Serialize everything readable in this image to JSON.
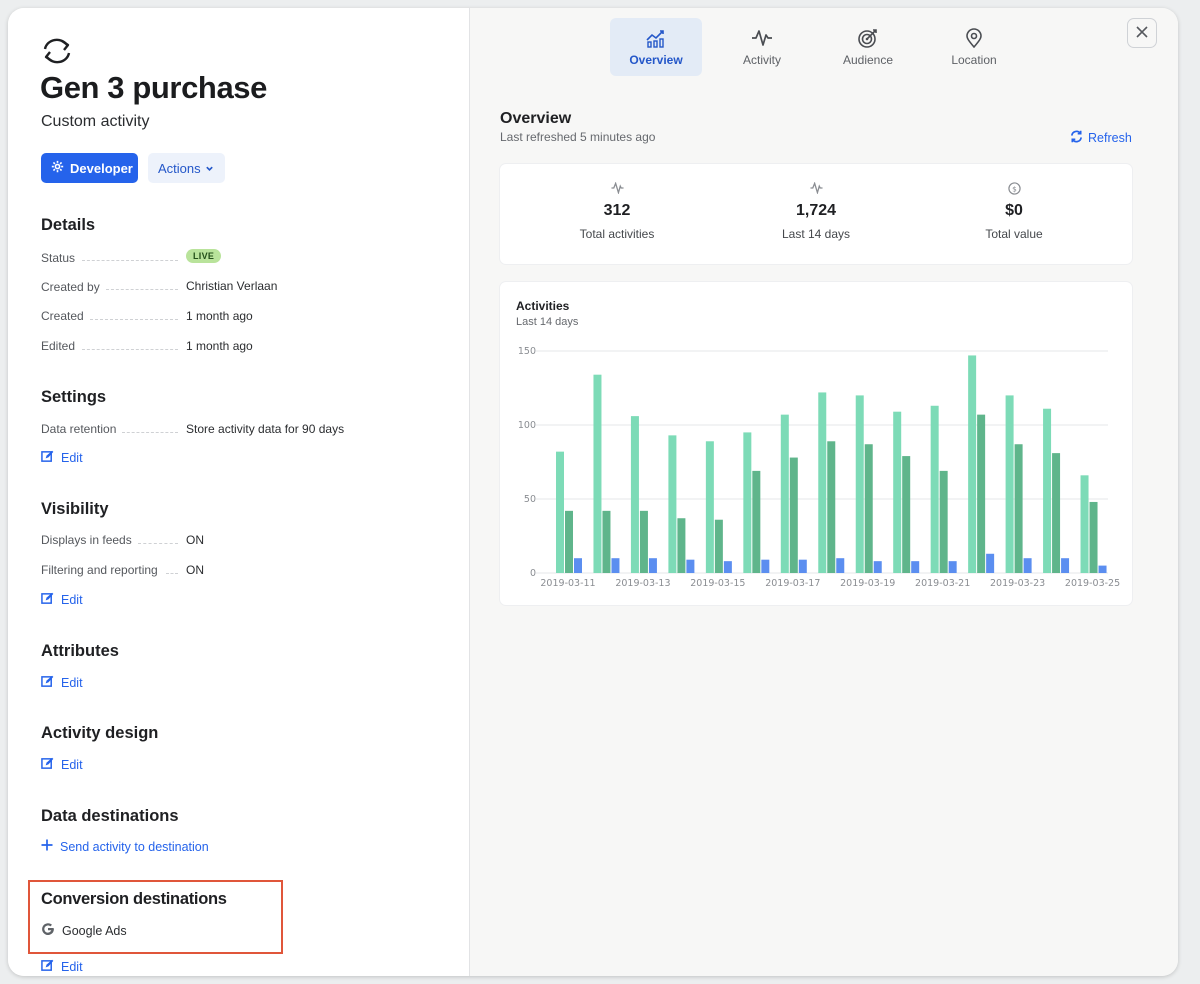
{
  "header": {
    "title": "Gen 3 purchase",
    "subtitle": "Custom activity"
  },
  "buttons": {
    "developer": "Developer",
    "actions": "Actions"
  },
  "details": {
    "heading": "Details",
    "rows": [
      {
        "label": "Status",
        "value": "LIVE"
      },
      {
        "label": "Created by",
        "value": "Christian Verlaan"
      },
      {
        "label": "Created",
        "value": "1 month ago"
      },
      {
        "label": "Edited",
        "value": "1 month ago"
      }
    ]
  },
  "settings": {
    "heading": "Settings",
    "rows": [
      {
        "label": "Data retention",
        "value": "Store activity data for 90 days"
      }
    ],
    "edit": "Edit"
  },
  "visibility": {
    "heading": "Visibility",
    "rows": [
      {
        "label": "Displays in feeds",
        "value": "ON"
      },
      {
        "label": "Filtering and reporting",
        "value": "ON"
      }
    ],
    "edit": "Edit"
  },
  "attributes": {
    "heading": "Attributes",
    "edit": "Edit"
  },
  "activity_design": {
    "heading": "Activity design",
    "edit": "Edit"
  },
  "data_destinations": {
    "heading": "Data destinations",
    "action": "Send activity to destination"
  },
  "conversion_destinations": {
    "heading": "Conversion destinations",
    "item": "Google Ads",
    "edit": "Edit"
  },
  "tabs": [
    {
      "label": "Overview",
      "icon": "chart-icon"
    },
    {
      "label": "Activity",
      "icon": "pulse-icon"
    },
    {
      "label": "Audience",
      "icon": "target-icon"
    },
    {
      "label": "Location",
      "icon": "pin-icon"
    }
  ],
  "overview": {
    "title": "Overview",
    "subtitle": "Last refreshed 5 minutes ago",
    "refresh": "Refresh",
    "stats": [
      {
        "value": "312",
        "label": "Total activities",
        "icon": "pulse-icon"
      },
      {
        "value": "1,724",
        "label": "Last 14 days",
        "icon": "pulse-icon"
      },
      {
        "value": "$0",
        "label": "Total value",
        "icon": "dollar-icon"
      }
    ]
  },
  "colors": {
    "accent": "#2563eb",
    "bar_light": "#7ddbb7",
    "bar_dark": "#5fb58b",
    "bar_blue": "#5b8ef0"
  },
  "chart_data": {
    "type": "bar",
    "title": "Activities",
    "subtitle": "Last 14 days",
    "categories": [
      "2019-03-11",
      "2019-03-12",
      "2019-03-13",
      "2019-03-14",
      "2019-03-15",
      "2019-03-16",
      "2019-03-17",
      "2019-03-18",
      "2019-03-19",
      "2019-03-20",
      "2019-03-21",
      "2019-03-22",
      "2019-03-23",
      "2019-03-24",
      "2019-03-25"
    ],
    "tick_labels": [
      "2019-03-11",
      "2019-03-13",
      "2019-03-15",
      "2019-03-17",
      "2019-03-19",
      "2019-03-21",
      "2019-03-23",
      "2019-03-25"
    ],
    "series": [
      {
        "values": [
          82,
          134,
          106,
          93,
          89,
          95,
          107,
          122,
          120,
          109,
          113,
          147,
          120,
          111,
          66
        ]
      },
      {
        "values": [
          42,
          42,
          42,
          37,
          36,
          69,
          78,
          89,
          87,
          79,
          69,
          107,
          87,
          81,
          48
        ]
      },
      {
        "values": [
          10,
          10,
          10,
          9,
          8,
          9,
          9,
          10,
          8,
          8,
          8,
          13,
          10,
          10,
          5
        ]
      }
    ],
    "yticks": [
      0,
      50,
      100,
      150
    ],
    "ylim": [
      0,
      150
    ],
    "grid": true
  }
}
